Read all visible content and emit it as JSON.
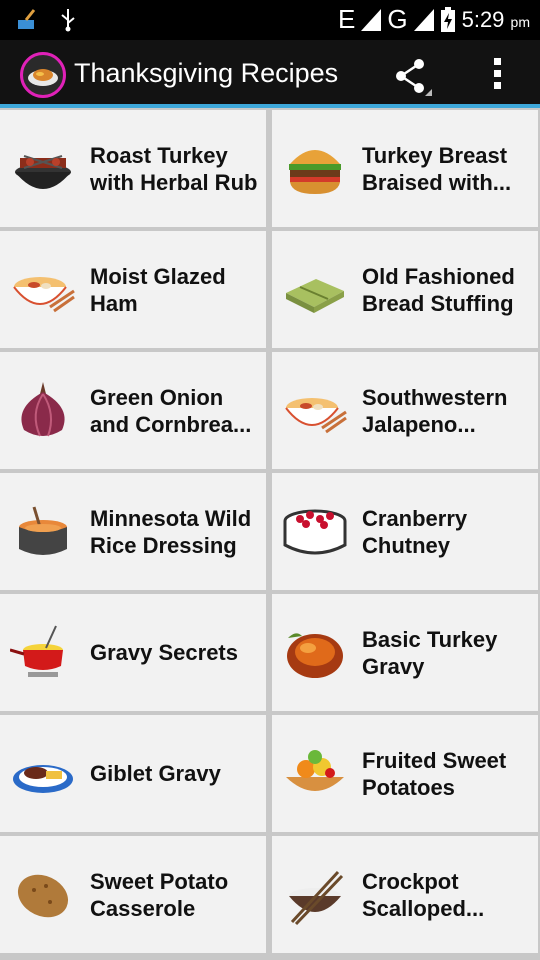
{
  "status_bar": {
    "network_1": "E",
    "network_2": "G",
    "time": "5:29",
    "time_suffix": "pm"
  },
  "app_bar": {
    "title": "Thanksgiving Recipes",
    "share_icon": "share-icon",
    "more_icon": "overflow-menu-icon",
    "accent_color": "#3da7d9"
  },
  "recipes": [
    {
      "name": "Roast Turkey with Herbal Rub",
      "icon": "grill-bowl-icon"
    },
    {
      "name": "Turkey Breast Braised with...",
      "icon": "burger-icon"
    },
    {
      "name": "Moist Glazed Ham",
      "icon": "noodle-bowl-icon"
    },
    {
      "name": "Old Fashioned Bread Stuffing",
      "icon": "wrapped-food-icon"
    },
    {
      "name": "Green Onion and Cornbrea...",
      "icon": "onion-icon"
    },
    {
      "name": "Southwestern Jalapeno...",
      "icon": "noodle-bowl-icon"
    },
    {
      "name": "Minnesota Wild Rice Dressing",
      "icon": "soup-pot-icon"
    },
    {
      "name": "Cranberry Chutney",
      "icon": "cranberry-dish-icon"
    },
    {
      "name": "Gravy Secrets",
      "icon": "fondue-pot-icon"
    },
    {
      "name": "Basic Turkey Gravy",
      "icon": "roast-turkey-icon"
    },
    {
      "name": "Giblet Gravy",
      "icon": "steak-plate-icon"
    },
    {
      "name": "Fruited Sweet Potatoes",
      "icon": "fruit-tart-icon"
    },
    {
      "name": "Sweet Potato Casserole",
      "icon": "potato-icon"
    },
    {
      "name": "Crockpot Scalloped...",
      "icon": "rice-bowl-icon"
    }
  ]
}
